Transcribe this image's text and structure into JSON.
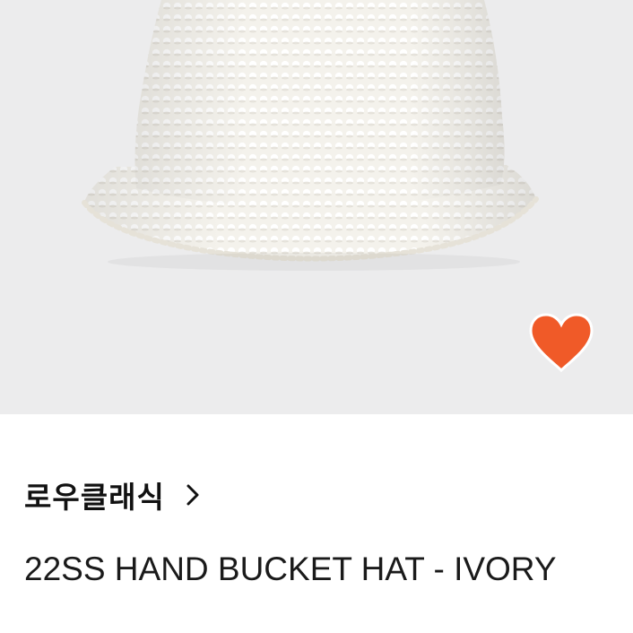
{
  "product": {
    "image_icon": "crochet-bucket-hat-photo",
    "wishlist_icon": "heart-icon",
    "wishlist_color": "#f05a28",
    "brand": "로우클래식",
    "brand_link_icon": "chevron-right-icon",
    "title": "22SS HAND BUCKET HAT - IVORY"
  },
  "colors": {
    "image_background": "#ececed",
    "hat": "#f3f1ea",
    "text": "#111111"
  }
}
